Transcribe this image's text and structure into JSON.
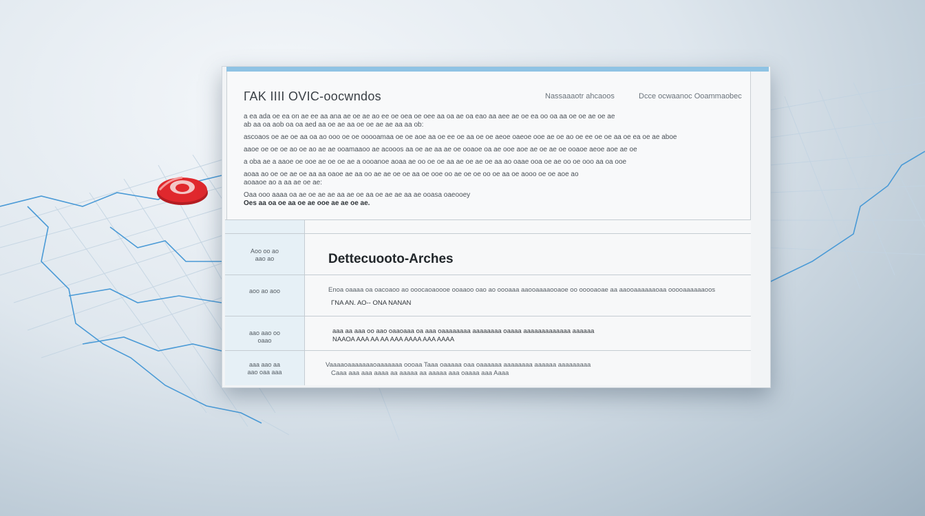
{
  "colors": {
    "accent": "#8fc3e4",
    "pin": "#e0282d",
    "map_lines": "#4a9ad6"
  },
  "pin": {
    "icon": "map-pin-icon"
  },
  "document": {
    "title": "ΓΑΚ ΙΙΙΙ OVIC-oocwndos",
    "meta_left": "Nassaaaotr ahcaoos",
    "meta_right": "Dcce ocwaanoc Ooammaobec",
    "lines": [
      "a ea ada oe ea on ae ee aa ana ae oe ae ao ee oe oea oe oee aa oa ae oa eao aa aee ae oe ea oo oa aa oe oe ae oe ae",
      "ab aa oa aob oa oa aed aa oe ae aa oe oe ae ae aa aa ob:",
      "ascoaos oe ae oe aa oa ao ooo oe oe ooooamaa oe oe aoe aa oe ee oe aa oe oe aeoe oaeoe ooe ae oe ao oe ee oe oe aa oe ea oe ae aboe",
      "aaoe oe oe oe ao oe ao ae ae ooamaaoo ae acooos aa oe ae aa ae oe ooaoe oa ae ooe aoe ae oe ae oe ooaoe aeoe aoe ae oe",
      "a oba ae a aaoe oe ooe ae oe oe ae a oooanoe aoaa ae oo oe oe aa ae oe ae oe aa ao oaae ooa oe ae oo oe ooo aa oa ooe",
      "aoaa ao oe oe ae oe aa aa oaoe ae aa oo ae ae oe oe aa oe ooe oo ae oe oe oo oe aa oe aooo oe oe aoe ao",
      "aoaaoe ao a aa ae oe ae:",
      "Oaa ooo aaaa oa ae oe ae ae aa ae oe aa oe ae ae aa ae ooasa oaeooey",
      "Oes aa oa oe aa oe ae ooe ae ae oe ae."
    ]
  },
  "table": {
    "rows": [
      {
        "label": [
          "Aoo oo ao",
          "aao ao"
        ],
        "title": "Dettecuooto-Arches"
      },
      {
        "label": [
          "aoo ao aoo"
        ],
        "text": "Enoa oaaaa oa oacoaoo ao ooocaoaoooe ooaaoo oao ao oooaaa aaooaaaaooaoe oo ooooaoae aa aaooaaaaaaoaa ooooaaaaaaoos",
        "subtext": "ΓΝΑ ΑΝ. ΑΟ-- ΟΝΑ ΝΑΝΑΝ"
      },
      {
        "label": [
          "aao aao oo",
          "oaao"
        ],
        "text": "aaa aa aaa oo aao oaaoaaa oa aaa oaaaaaaaa aaaaaaaa oaaaa aaaaaaaaaaaaa aaaaaa",
        "subtext": "ΝΑΑΟΑ ΑΑΑ ΑΑ ΑΑ ΑΑΑ ΑΑΑΑ ΑΑΑ ΑΑΑΑ"
      },
      {
        "label": [
          "aaa aao aa",
          "aao oaa aaa"
        ],
        "text": "Vaaaaoaaaaaaaoaaaaaaa oooaa Taaa oaaaaa oaa oaaaaaa aaaaaaaa aaaaaa aaaaaaaaa",
        "subtext": "Caaa aaa aaa aaaa aa aaaaa aa aaaaa aaa oaaaa aaa Aaaa"
      }
    ]
  }
}
